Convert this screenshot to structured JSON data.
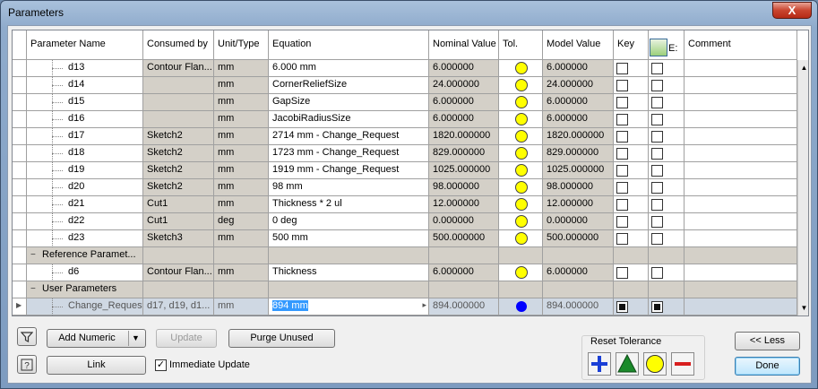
{
  "window": {
    "title": "Parameters",
    "close": "X"
  },
  "columns": [
    "Parameter Name",
    "Consumed by",
    "Unit/Type",
    "Equation",
    "Nominal Value",
    "Tol.",
    "Model Value",
    "Key",
    "E:",
    "Comment"
  ],
  "rows": [
    {
      "type": "param",
      "name": "d13",
      "consumed": "Contour Flan...",
      "unit": "mm",
      "equation": "6.000 mm",
      "nominal": "6.000000",
      "tol": "yellow",
      "model": "6.000000",
      "key": false,
      "export": false
    },
    {
      "type": "param",
      "name": "d14",
      "consumed": "",
      "unit": "mm",
      "equation": "CornerReliefSize",
      "nominal": "24.000000",
      "tol": "yellow",
      "model": "24.000000",
      "key": false,
      "export": false
    },
    {
      "type": "param",
      "name": "d15",
      "consumed": "",
      "unit": "mm",
      "equation": "GapSize",
      "nominal": "6.000000",
      "tol": "yellow",
      "model": "6.000000",
      "key": false,
      "export": false
    },
    {
      "type": "param",
      "name": "d16",
      "consumed": "",
      "unit": "mm",
      "equation": "JacobiRadiusSize",
      "nominal": "6.000000",
      "tol": "yellow",
      "model": "6.000000",
      "key": false,
      "export": false
    },
    {
      "type": "param",
      "name": "d17",
      "consumed": "Sketch2",
      "unit": "mm",
      "equation": "2714 mm - Change_Request",
      "nominal": "1820.000000",
      "tol": "yellow",
      "model": "1820.000000",
      "key": false,
      "export": false
    },
    {
      "type": "param",
      "name": "d18",
      "consumed": "Sketch2",
      "unit": "mm",
      "equation": "1723 mm - Change_Request",
      "nominal": "829.000000",
      "tol": "yellow",
      "model": "829.000000",
      "key": false,
      "export": false
    },
    {
      "type": "param",
      "name": "d19",
      "consumed": "Sketch2",
      "unit": "mm",
      "equation": "1919 mm - Change_Request",
      "nominal": "1025.000000",
      "tol": "yellow",
      "model": "1025.000000",
      "key": false,
      "export": false
    },
    {
      "type": "param",
      "name": "d20",
      "consumed": "Sketch2",
      "unit": "mm",
      "equation": "98 mm",
      "nominal": "98.000000",
      "tol": "yellow",
      "model": "98.000000",
      "key": false,
      "export": false
    },
    {
      "type": "param",
      "name": "d21",
      "consumed": "Cut1",
      "unit": "mm",
      "equation": "Thickness * 2 ul",
      "nominal": "12.000000",
      "tol": "yellow",
      "model": "12.000000",
      "key": false,
      "export": false
    },
    {
      "type": "param",
      "name": "d22",
      "consumed": "Cut1",
      "unit": "deg",
      "equation": "0 deg",
      "nominal": "0.000000",
      "tol": "yellow",
      "model": "0.000000",
      "key": false,
      "export": false
    },
    {
      "type": "param",
      "name": "d23",
      "consumed": "Sketch3",
      "unit": "mm",
      "equation": "500 mm",
      "nominal": "500.000000",
      "tol": "yellow",
      "model": "500.000000",
      "key": false,
      "export": false
    },
    {
      "type": "group",
      "name": "Reference Paramet..."
    },
    {
      "type": "param",
      "name": "d6",
      "consumed": "Contour Flan...",
      "unit": "mm",
      "equation": "Thickness",
      "nominal": "6.000000",
      "tol": "yellow",
      "model": "6.000000",
      "key": false,
      "export": false
    },
    {
      "type": "group",
      "name": "User Parameters"
    },
    {
      "type": "selected",
      "name": "Change_Request",
      "consumed": "d17, d19, d1...",
      "unit": "mm",
      "equation": "894 mm",
      "nominal": "894.000000",
      "tol": "blue",
      "model": "894.000000",
      "key": true,
      "export": true
    }
  ],
  "buttons": {
    "filter": "filter-icon",
    "add_numeric": "Add Numeric",
    "update": "Update",
    "purge_unused": "Purge Unused",
    "help": "help-icon",
    "link": "Link",
    "immediate_update": "Immediate Update",
    "reset_tolerance": "Reset Tolerance",
    "less": "<< Less",
    "done": "Done"
  },
  "immediate_update_checked": true,
  "colors": {
    "tol_yellow": "#ffff00",
    "tol_blue": "#0000ff",
    "tol_plus": "#1a3fd6",
    "tol_triangle": "#1b8a2b",
    "tol_minus": "#d81f1f"
  }
}
